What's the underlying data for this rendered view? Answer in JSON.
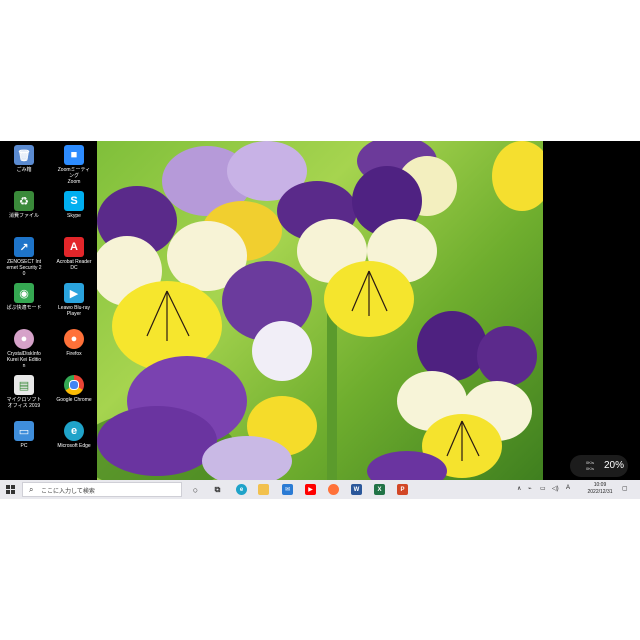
{
  "desktop": {
    "icons": [
      {
        "label": "ごみ箱",
        "icon": "recycle-bin-icon",
        "color": "#5b8bd1"
      },
      {
        "label": "Zoomミーティング\nZoom",
        "icon": "zoom-icon",
        "color": "#2d8cff"
      },
      {
        "label": "消費ファイル",
        "icon": "recycle-file-icon",
        "color": "#3a8a3a"
      },
      {
        "label": "Skype",
        "icon": "skype-icon",
        "color": "#00aff0"
      },
      {
        "label": "ZENOSECT Internet Security 20",
        "icon": "security-icon",
        "color": "#1e74c9"
      },
      {
        "label": "Acrobat Reader DC",
        "icon": "acrobat-icon",
        "color": "#e3262a"
      },
      {
        "label": "ぱぶ快適モード",
        "icon": "eye-mode-icon",
        "color": "#35a852"
      },
      {
        "label": "Leawo Blu-ray Player",
        "icon": "bluray-player-icon",
        "color": "#2aa3dd"
      },
      {
        "label": "CrystalDiskInfo Kurei Kei Edition",
        "icon": "crystaldiskinfo-icon",
        "color": "#d6a2c9"
      },
      {
        "label": "Firefox",
        "icon": "firefox-icon",
        "color": "#ff7139"
      },
      {
        "label": "マイクロソフトオフィス 2019",
        "icon": "office-icon",
        "color": "#e8e8e8"
      },
      {
        "label": "Google Chrome",
        "icon": "chrome-icon",
        "color": "#4285f4"
      },
      {
        "label": "PC",
        "icon": "pc-icon",
        "color": "#3f8edb"
      },
      {
        "label": "Microsoft Edge",
        "icon": "edge-icon",
        "color": "#1fa3c9"
      }
    ]
  },
  "taskbar": {
    "search_placeholder": "ここに入力して検索",
    "apps": [
      {
        "icon": "cortana-icon",
        "color": "#333333"
      },
      {
        "icon": "task-view-icon",
        "color": "#333333"
      },
      {
        "icon": "edge-icon",
        "color": "#1fa3c9"
      },
      {
        "icon": "file-explorer-icon",
        "color": "#f2c14e"
      },
      {
        "icon": "mail-icon",
        "color": "#2b7bd4"
      },
      {
        "icon": "youtube-icon",
        "color": "#ff0000"
      },
      {
        "icon": "firefox-icon",
        "color": "#ff7139"
      },
      {
        "icon": "word-icon",
        "color": "#2b579a"
      },
      {
        "icon": "excel-icon",
        "color": "#217346"
      },
      {
        "icon": "powerpoint-icon",
        "color": "#d24726"
      }
    ],
    "tray": {
      "ime": "A",
      "time": "10:09",
      "date": "2022/12/31"
    }
  },
  "net_widget": {
    "up": "0K/s",
    "down": "0K/s",
    "percent": "20%"
  }
}
